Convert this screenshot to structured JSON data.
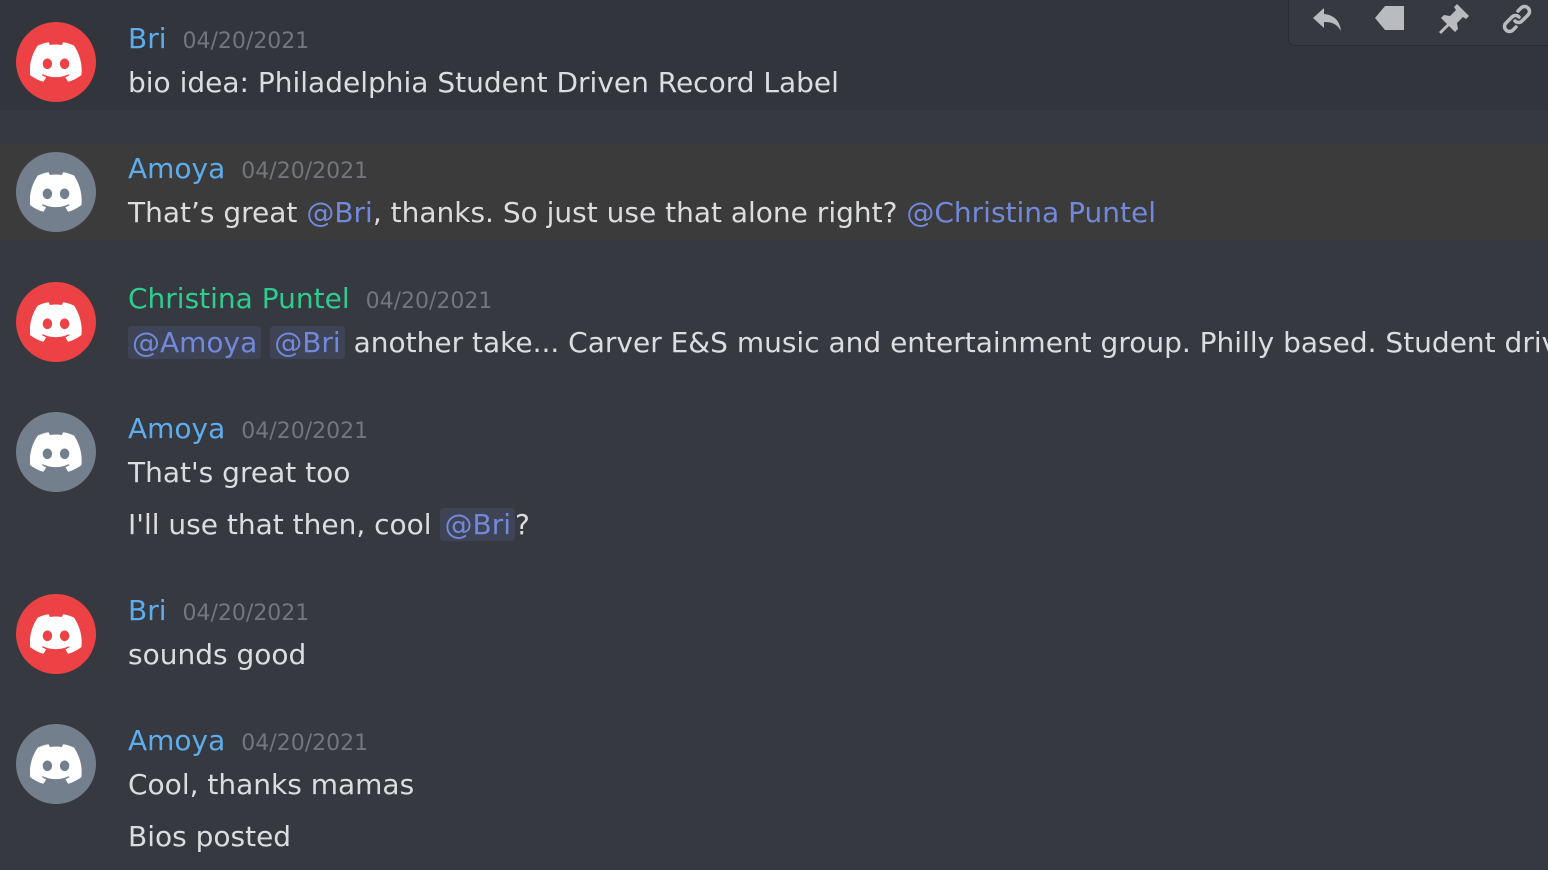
{
  "toolbar": {
    "icons": [
      "reply-icon",
      "tag-icon",
      "pin-icon",
      "link-icon"
    ]
  },
  "colors": {
    "background": "#36393f",
    "bri_name": "#5dadec",
    "amoya_name": "#5dadec",
    "christina_name": "#2ecc8f",
    "mention": "#7289da",
    "avatar_red": "#ed4245",
    "avatar_grey": "#747f8d",
    "timestamp": "#72767d",
    "text": "#dcddde"
  },
  "messages": [
    {
      "author": "Bri",
      "timestamp": "04/20/2021",
      "line1": "bio idea: Philadelphia Student Driven Record Label"
    },
    {
      "author": "Amoya",
      "timestamp": "04/20/2021",
      "line1_a": "That’s great ",
      "mention_1": "@Bri",
      "line1_b": ", thanks. So just use that alone right? ",
      "mention_2": "@Christina Puntel"
    },
    {
      "author": "Christina Puntel",
      "timestamp": "04/20/2021",
      "mention_1": "@Amoya",
      "mention_2": "@Bri",
      "line1_b": " another take... Carver E&S music and entertainment group. Philly based. Student driven."
    },
    {
      "author": "Amoya",
      "timestamp": "04/20/2021",
      "line1": "That's great too",
      "line2_a": "I'll use that then, cool ",
      "mention_1": "@Bri",
      "line2_b": "?"
    },
    {
      "author": "Bri",
      "timestamp": "04/20/2021",
      "line1": "sounds good"
    },
    {
      "author": "Amoya",
      "timestamp": "04/20/2021",
      "line1": "Cool, thanks mamas",
      "line2": "Bios posted"
    }
  ]
}
